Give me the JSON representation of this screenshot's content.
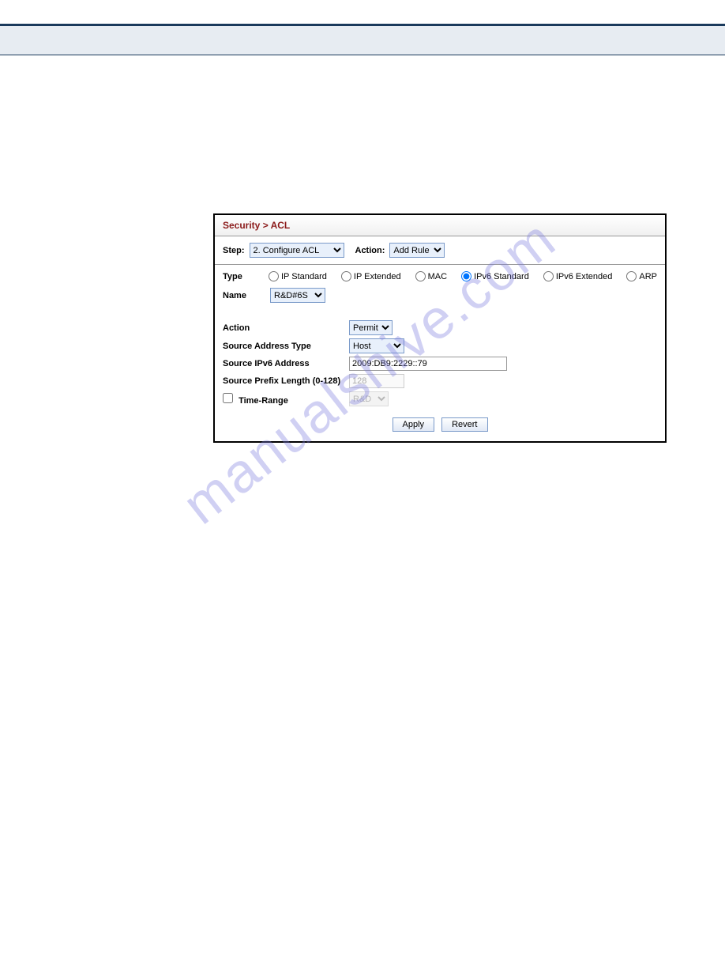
{
  "breadcrumb": "Security > ACL",
  "step": {
    "label": "Step:",
    "value": "2. Configure ACL",
    "action_label": "Action:",
    "action_value": "Add Rule"
  },
  "type": {
    "label": "Type",
    "options": [
      "IP Standard",
      "IP Extended",
      "MAC",
      "IPv6 Standard",
      "IPv6 Extended",
      "ARP"
    ],
    "selected": "IPv6 Standard"
  },
  "name": {
    "label": "Name",
    "value": "R&D#6S"
  },
  "form": {
    "action_label": "Action",
    "action_value": "Permit",
    "src_addr_type_label": "Source Address Type",
    "src_addr_type_value": "Host",
    "src_ipv6_label": "Source IPv6 Address",
    "src_ipv6_value": "2009:DB9:2229::79",
    "prefix_label": "Source Prefix Length (0-128)",
    "prefix_value": "128",
    "timerange_label": "Time-Range",
    "timerange_value": "R&D",
    "timerange_checked": false
  },
  "buttons": {
    "apply": "Apply",
    "revert": "Revert"
  },
  "watermark": "manualshive.com"
}
